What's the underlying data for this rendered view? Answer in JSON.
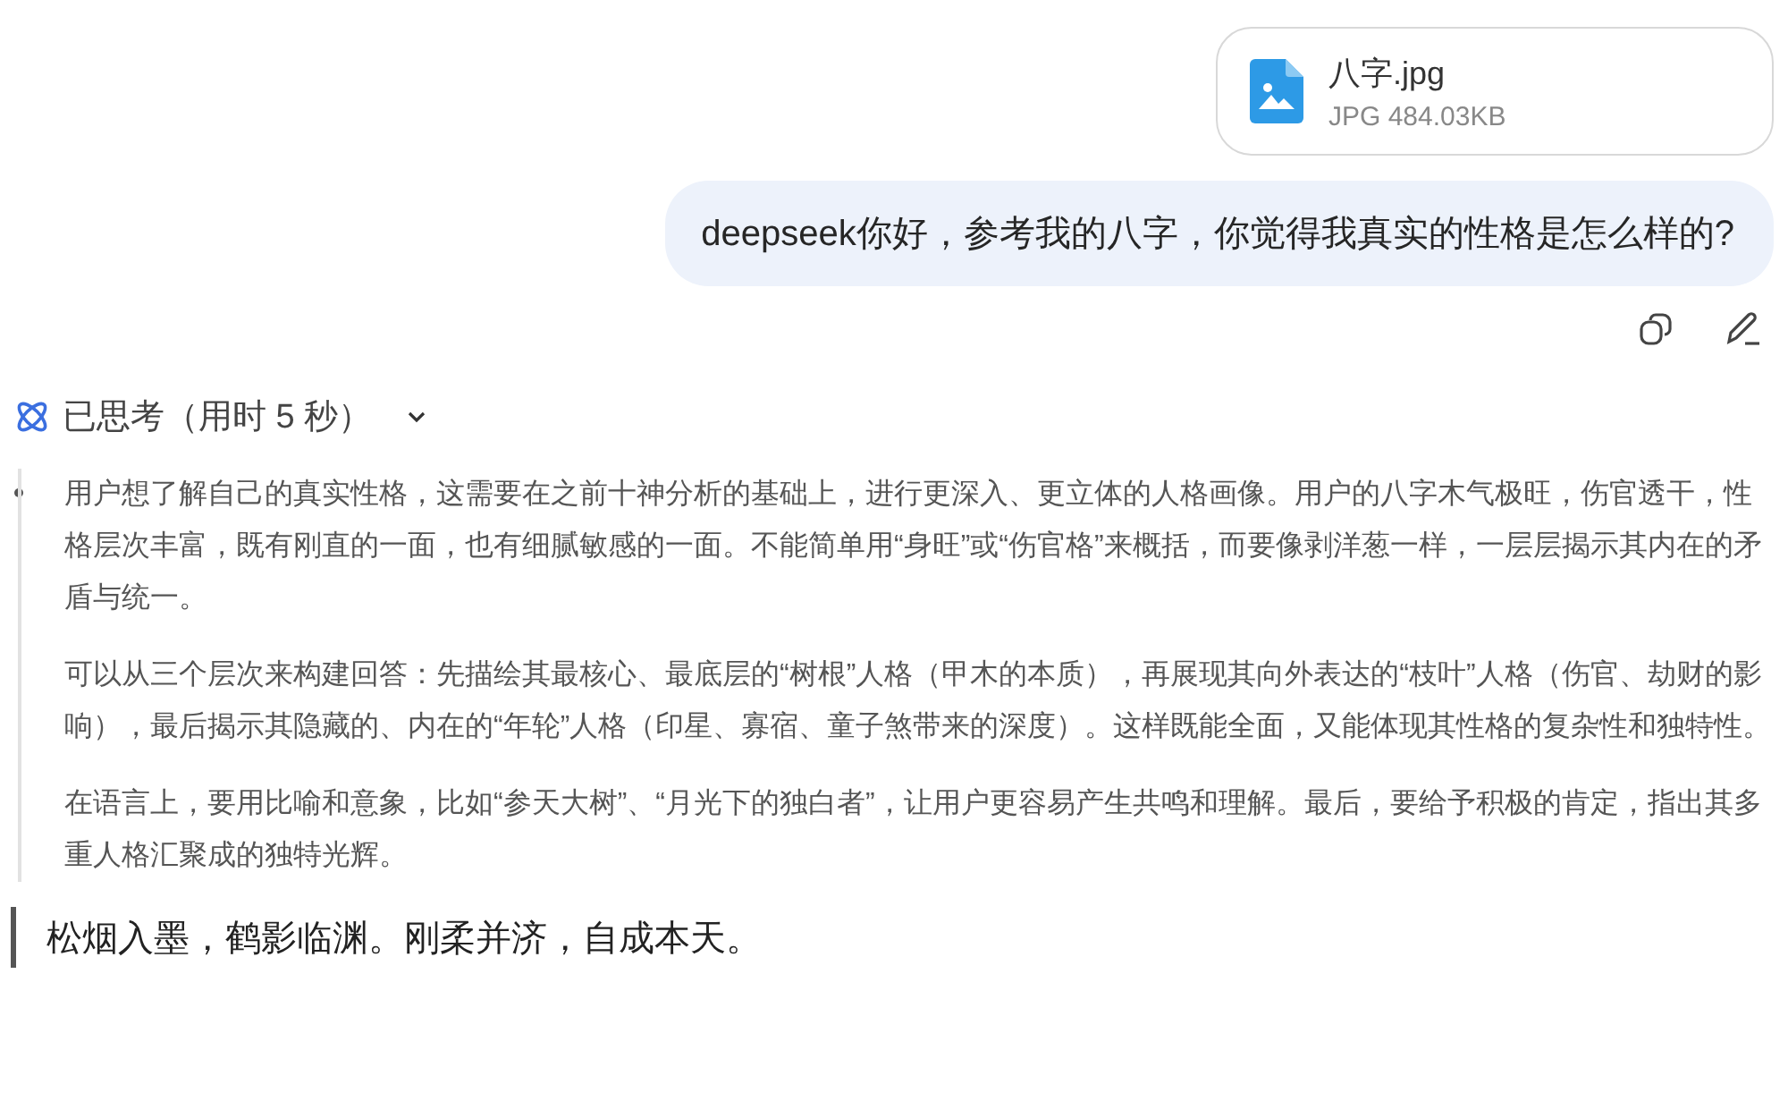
{
  "attachment": {
    "name": "八字.jpg",
    "meta": "JPG 484.03KB"
  },
  "user_message": {
    "text": "deepseek你好，参考我的八字，你觉得我真实的性格是怎么样的?"
  },
  "thinking": {
    "label": "已思考（用时 5 秒）",
    "expanded": true,
    "paragraphs": [
      "用户想了解自己的真实性格，这需要在之前十神分析的基础上，进行更深入、更立体的人格画像。用户的八字木气极旺，伤官透干，性格层次丰富，既有刚直的一面，也有细腻敏感的一面。不能简单用“身旺”或“伤官格”来概括，而要像剥洋葱一样，一层层揭示其内在的矛盾与统一。",
      "可以从三个层次来构建回答：先描绘其最核心、最底层的“树根”人格（甲木的本质），再展现其向外表达的“枝叶”人格（伤官、劫财的影响），最后揭示其隐藏的、内在的“年轮”人格（印星、寡宿、童子煞带来的深度）。这样既能全面，又能体现其性格的复杂性和独特性。",
      "在语言上，要用比喻和意象，比如“参天大树”、“月光下的独白者”，让用户更容易产生共鸣和理解。最后，要给予积极的肯定，指出其多重人格汇聚成的独特光辉。"
    ]
  },
  "answer": {
    "text": "松烟入墨，鹤影临渊。刚柔并济，自成本天。"
  }
}
